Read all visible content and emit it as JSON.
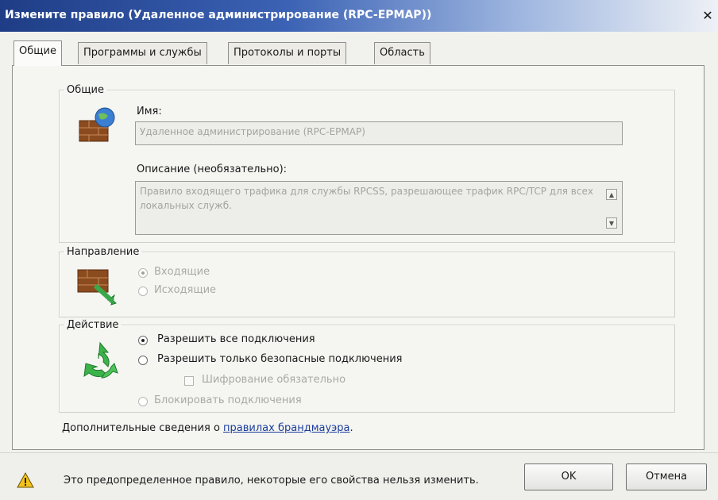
{
  "window": {
    "title": "Измените правило (Удаленное администрирование (RPC-EPMAP))",
    "close": "✕"
  },
  "tabs": [
    {
      "label": "Общие",
      "active": true
    },
    {
      "label": "Программы и службы",
      "active": false
    },
    {
      "label": "Протоколы и порты",
      "active": false
    },
    {
      "label": "Область",
      "active": false
    }
  ],
  "general": {
    "legend": "Общие",
    "name_label": "Имя:",
    "name_value": "Удаленное администрирование (RPC-EPMAP)",
    "description_label": "Описание (необязательно):",
    "description_value": "Правило входящего трафика для службы RPCSS, разрешающее трафик RPC/TCP для всех локальных служб."
  },
  "direction": {
    "legend": "Направление",
    "options": [
      {
        "label": "Входящие",
        "selected": true,
        "enabled": false
      },
      {
        "label": "Исходящие",
        "selected": false,
        "enabled": false
      }
    ]
  },
  "action": {
    "legend": "Действие",
    "options": [
      {
        "label": "Разрешить все подключения",
        "selected": true,
        "enabled": true
      },
      {
        "label": "Разрешить только безопасные подключения",
        "selected": false,
        "enabled": true
      },
      {
        "label": "Блокировать подключения",
        "selected": false,
        "enabled": false
      }
    ],
    "encryption_label": "Шифрование обязательно"
  },
  "more_info": {
    "prefix": "Дополнительные сведения о ",
    "link": "правилах брандмауэра",
    "suffix": "."
  },
  "footer": {
    "warning": "Это предопределенное правило, некоторые его свойства нельзя изменить.",
    "ok": "OK",
    "cancel": "Отмена"
  },
  "icons": {
    "general": "globe-brick-firewall-icon",
    "direction": "firewall-arrow-icon",
    "action": "recycle-arrows-icon",
    "warning": "warning-triangle-icon"
  }
}
